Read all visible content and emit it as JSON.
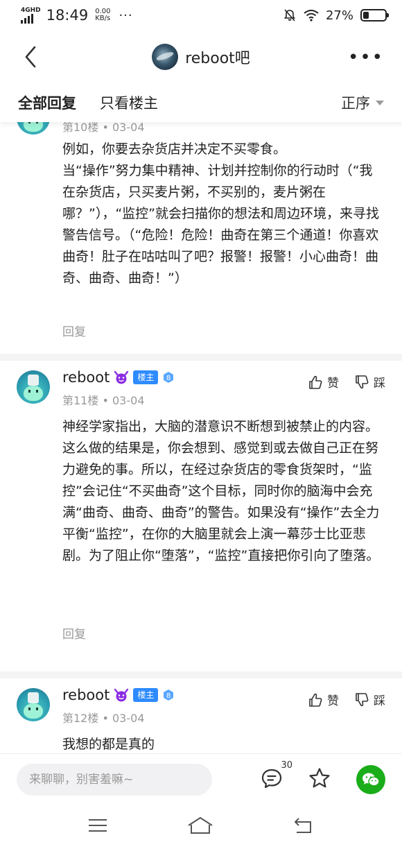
{
  "status_bar": {
    "network": "4GHD",
    "time": "18:49",
    "speed_value": "0.00",
    "speed_unit": "KB/s",
    "more": "···",
    "battery_percent": "27%",
    "battery_level": 0.27
  },
  "header": {
    "forum_name": "reboot吧",
    "more": "•••"
  },
  "tabs": {
    "all_replies": "全部回复",
    "only_op": "只看楼主",
    "sort_label": "正序"
  },
  "posts": [
    {
      "meta_floor": "第10楼",
      "meta_sep": "•",
      "meta_date": "03-04",
      "body": "例如，你要去杂货店并决定不买零食。\n当“操作”努力集中精神、计划并控制你的行动时（“我在杂货店，只买麦片粥，不买别的，麦片粥在哪？”），“监控”就会扫描你的想法和周边环境，来寻找警告信号。（“危险！危险！曲奇在第三个通道！你喜欢曲奇！肚子在咕咕叫了吧？报警！报警！小心曲奇！曲奇、曲奇、曲奇！”）",
      "reply": "回复"
    },
    {
      "username": "reboot",
      "owner_badge": "楼主",
      "level": "8",
      "meta_floor": "第11楼",
      "meta_sep": "•",
      "meta_date": "03-04",
      "like": "赞",
      "dislike": "踩",
      "body": "神经学家指出，大脑的潜意识不断想到被禁止的内容。这么做的结果是，你会想到、感觉到或去做自己正在努力避免的事。所以，在经过杂货店的零食货架时，“监控”会记住“不买曲奇”这个目标，同时你的脑海中会充满“曲奇、曲奇、曲奇”的警告。如果没有“操作”去全力平衡“监控”，在你的大脑里就会上演一幕莎士比亚悲剧。为了阻止你“堕落”，“监控”直接把你引向了堕落。",
      "reply": "回复"
    },
    {
      "username": "reboot",
      "owner_badge": "楼主",
      "level": "8",
      "meta_floor": "第12楼",
      "meta_sep": "•",
      "meta_date": "03-04",
      "like": "赞",
      "dislike": "踩",
      "body": "我想的都是真的"
    }
  ],
  "bottom_bar": {
    "input_placeholder": "来聊聊，别害羞嘛~",
    "comment_count": "30"
  },
  "icons": {
    "back": "chevron-left-icon",
    "like": "thumbs-up-icon",
    "dislike": "thumbs-down-icon",
    "comment": "comment-icon",
    "star": "star-icon",
    "wechat": "wechat-icon",
    "menu": "menu-icon",
    "home": "home-icon",
    "return": "return-icon"
  },
  "colors": {
    "owner_badge": "#2e8bff",
    "wechat": "#1aad19",
    "meta_text": "#999999"
  }
}
